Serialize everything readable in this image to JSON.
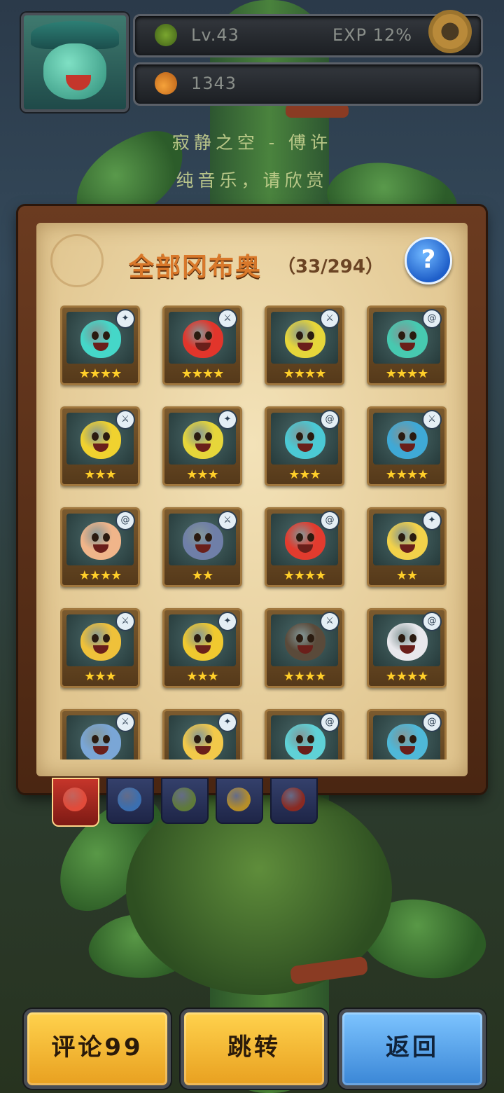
{
  "hud": {
    "level": "Lv.43",
    "exp": "EXP 12%",
    "currency": "1343"
  },
  "song": {
    "line1": "寂静之空 - 傅许",
    "line2": "纯音乐，请欣赏"
  },
  "panel": {
    "title": "全部冈布奥",
    "count": "（33/294）",
    "help_label": "?"
  },
  "cards": [
    {
      "stars": "★★★★",
      "color": "#45d7c8",
      "badge": "compass"
    },
    {
      "stars": "★★★★",
      "color": "#e2352b",
      "badge": "sword"
    },
    {
      "stars": "★★★★",
      "color": "#e6d63a",
      "badge": "sword"
    },
    {
      "stars": "★★★★",
      "color": "#47c9b0",
      "badge": "swirl"
    },
    {
      "stars": "★★★",
      "color": "#f0d22f",
      "badge": "sword"
    },
    {
      "stars": "★★★",
      "color": "#e6d63a",
      "badge": "compass"
    },
    {
      "stars": "★★★",
      "color": "#4bc9d4",
      "badge": "swirl"
    },
    {
      "stars": "★★★★",
      "color": "#3fa9d6",
      "badge": "sword"
    },
    {
      "stars": "★★★★",
      "color": "#f0b58a",
      "badge": "swirl"
    },
    {
      "stars": "★★",
      "color": "#6f7fa8",
      "badge": "sword"
    },
    {
      "stars": "★★★★",
      "color": "#e23b2e",
      "badge": "swirl"
    },
    {
      "stars": "★★",
      "color": "#f2d24a",
      "badge": "compass"
    },
    {
      "stars": "★★★",
      "color": "#efc13a",
      "badge": "sword"
    },
    {
      "stars": "★★★",
      "color": "#f0c92f",
      "badge": "compass"
    },
    {
      "stars": "★★★★",
      "color": "#5a4a3a",
      "badge": "sword"
    },
    {
      "stars": "★★★★",
      "color": "#e8e8ec",
      "badge": "swirl"
    },
    {
      "stars": "",
      "color": "#7aa6d6",
      "badge": "sword"
    },
    {
      "stars": "",
      "color": "#f2c94a",
      "badge": "compass"
    },
    {
      "stars": "",
      "color": "#5fd1d6",
      "badge": "swirl"
    },
    {
      "stars": "",
      "color": "#4fb8d8",
      "badge": "swirl"
    }
  ],
  "tabs": [
    {
      "name": "all",
      "color": "#e24b3a"
    },
    {
      "name": "blue",
      "color": "#3b6fb0"
    },
    {
      "name": "green",
      "color": "#5f7a3a"
    },
    {
      "name": "yellow",
      "color": "#b58e2a"
    },
    {
      "name": "red",
      "color": "#8a2a22"
    }
  ],
  "buttons": {
    "comment": "评论99",
    "jump": "跳转",
    "back": "返回"
  }
}
